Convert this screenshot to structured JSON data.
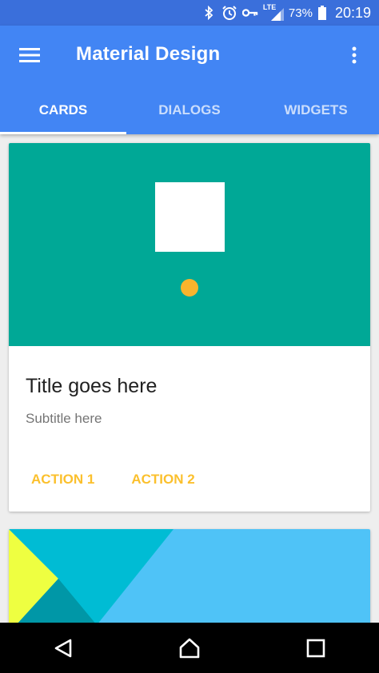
{
  "status_bar": {
    "network": "LTE",
    "battery": "73%",
    "time": "20:19",
    "icons": [
      "bluetooth-icon",
      "alarm-icon",
      "vpn-key-icon",
      "signal-icon",
      "battery-icon"
    ]
  },
  "app_bar": {
    "title": "Material Design",
    "color": "#4285f4",
    "icons": [
      "menu-icon",
      "more-vert-icon"
    ]
  },
  "tabs": [
    {
      "label": "CARDS",
      "active": true
    },
    {
      "label": "DIALOGS",
      "active": false
    },
    {
      "label": "WIDGETS",
      "active": false
    }
  ],
  "cards": [
    {
      "title": "Title goes here",
      "subtitle": "Subtitle here",
      "media_color": "#00a896",
      "actions": [
        "ACTION 1",
        "ACTION 2"
      ],
      "action_color": "#fbc02d"
    }
  ],
  "nav_bar": {
    "icons": [
      "back-icon",
      "home-icon",
      "recents-icon"
    ]
  }
}
